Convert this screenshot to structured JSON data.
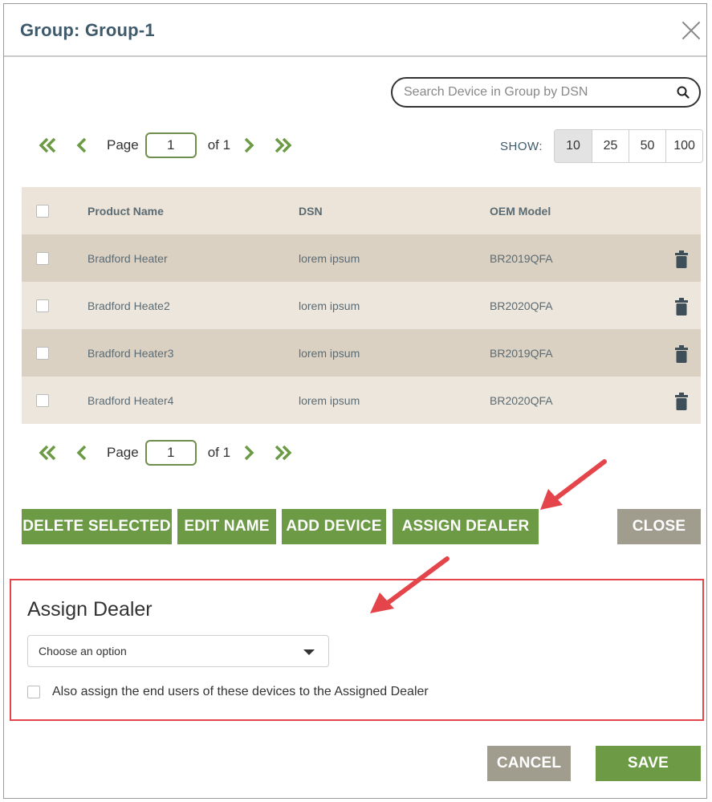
{
  "dialog": {
    "title": "Group: Group-1"
  },
  "search": {
    "placeholder": "Search Device in Group by DSN"
  },
  "pager": {
    "page_label": "Page",
    "page_value": "1",
    "of_label": "of 1"
  },
  "show": {
    "label": "SHOW:",
    "options": [
      "10",
      "25",
      "50",
      "100"
    ],
    "selected": "10"
  },
  "table": {
    "headers": [
      "Product Name",
      "DSN",
      "OEM Model"
    ],
    "rows": [
      {
        "product": "Bradford Heater",
        "dsn": "lorem ipsum",
        "model": "BR2019QFA"
      },
      {
        "product": "Bradford Heate2",
        "dsn": "lorem ipsum",
        "model": "BR2020QFA"
      },
      {
        "product": "Bradford Heater3",
        "dsn": "lorem ipsum",
        "model": "BR2019QFA"
      },
      {
        "product": "Bradford Heater4",
        "dsn": "lorem ipsum",
        "model": "BR2020QFA"
      }
    ]
  },
  "actions": {
    "delete_selected": "DELETE SELECTED",
    "edit_name": "EDIT NAME",
    "add_device": "ADD DEVICE",
    "assign_dealer": "ASSIGN DEALER",
    "close": "CLOSE"
  },
  "assign": {
    "title": "Assign Dealer",
    "select_value": "Choose an option",
    "also_label": "Also assign the end users of these devices to the Assigned Dealer"
  },
  "footer": {
    "cancel": "CANCEL",
    "save": "SAVE"
  },
  "colors": {
    "green": "#6c9a45",
    "grey": "#a09d8e",
    "highlight": "#e3454a",
    "row_dark": "#dbd1c3",
    "row_light": "#ede6dc"
  }
}
